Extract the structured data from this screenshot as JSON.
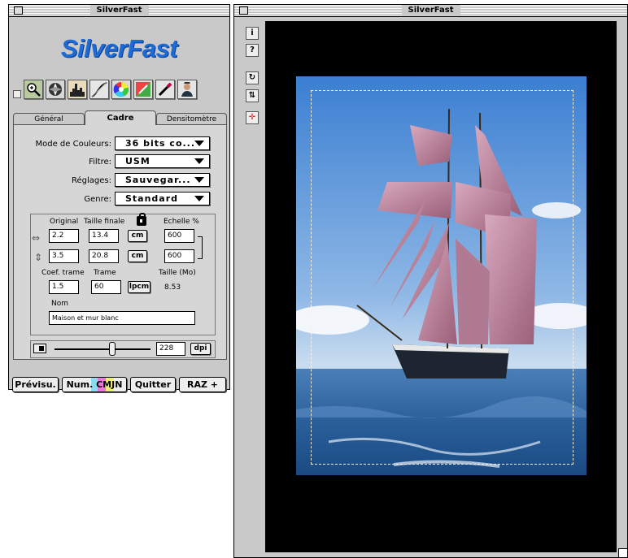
{
  "control_window": {
    "title": "SilverFast",
    "logo_text": "SilverFast",
    "tools": [
      "zoom-icon",
      "aperture-icon",
      "histogram-icon",
      "gradation-curve-icon",
      "color-wheel-icon",
      "color-correction-icon",
      "pipette-icon",
      "scanner-operator-icon"
    ],
    "tabs": [
      {
        "label": "Général"
      },
      {
        "label": "Cadre"
      },
      {
        "label": "Densitomètre"
      }
    ],
    "mode_label": "Mode de Couleurs:",
    "mode_value": "36 bits co...",
    "filtre_label": "Filtre:",
    "filtre_value": "USM",
    "reglages_label": "Réglages:",
    "reglages_value": "Sauvegar...",
    "genre_label": "Genre:",
    "genre_value": "Standard",
    "dims": {
      "original_header": "Original",
      "taille_header": "Taille finale",
      "echelle_header": "Echelle %",
      "width_original": "2.2",
      "width_taille": "13.4",
      "width_unit": "cm",
      "width_scale": "600",
      "height_original": "3.5",
      "height_taille": "20.8",
      "height_unit": "cm",
      "height_scale": "600",
      "coef_header": "Coef. trame",
      "trame_header": "Trame",
      "tailleMo_header": "Taille (Mo)",
      "coef_value": "1.5",
      "trame_value": "60",
      "trame_unit": "lpcm",
      "tailleMo_value": "8.53",
      "nom_header": "Nom",
      "nom_value": "Maison et mur blanc"
    },
    "resolution_value": "228",
    "resolution_unit": "dpi",
    "resolution_slider_fraction": 0.6,
    "buttons": {
      "previsu": "Prévisu.",
      "num_cmjn": "Num. CMJN",
      "quitter": "Quitter",
      "raz": "RAZ +"
    }
  },
  "preview_window": {
    "title": "SilverFast",
    "side_buttons": [
      "info-icon",
      "help-icon",
      "rotate-icon",
      "flip-icon",
      "airplane-icon"
    ]
  }
}
